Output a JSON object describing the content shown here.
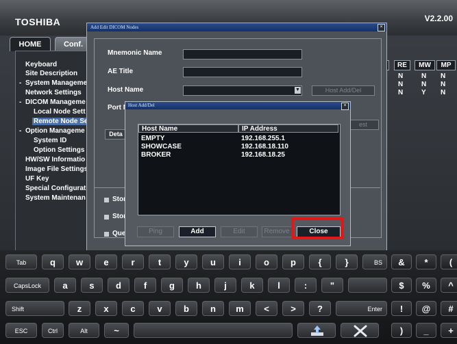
{
  "app": {
    "brand": "TOSHIBA",
    "version": "V2.2.00"
  },
  "tabs": [
    {
      "label": "HOME"
    },
    {
      "label": "Conf."
    }
  ],
  "tree": [
    {
      "label": "Keyboard"
    },
    {
      "label": "Site Description"
    },
    {
      "label": "System Manageme"
    },
    {
      "label": "Network Settings"
    },
    {
      "label": "DICOM Manageme"
    },
    {
      "label": "Local Node Sett"
    },
    {
      "label": "Remote Node Se"
    },
    {
      "label": "Option Manageme"
    },
    {
      "label": "System ID"
    },
    {
      "label": "Option Settings"
    },
    {
      "label": "HW/SW Informatio"
    },
    {
      "label": "Image File Settings"
    },
    {
      "label": "UF Key"
    },
    {
      "label": "Special Configurat"
    },
    {
      "label": "System Maintenan"
    }
  ],
  "right_table": {
    "headers": [
      "J",
      "RE",
      "MW",
      "MP"
    ],
    "rows": [
      [
        "N",
        "N",
        "N"
      ],
      [
        "N",
        "N",
        "N"
      ],
      [
        "N",
        "Y",
        "N"
      ]
    ]
  },
  "dicom_dialog": {
    "title": "Add Edit DICOM Nodes",
    "close_glyph": "×",
    "fields": {
      "mnemonic_label": "Mnemonic Name",
      "ae_title_label": "AE Title",
      "host_name_label": "Host Name",
      "port_label": "Port N"
    },
    "host_add_del_button": "Host Add/Del",
    "detail_button": "Deta",
    "test_button": "est",
    "checkbox_labels": [
      "Stor",
      "Stor",
      "Que"
    ]
  },
  "host_dialog": {
    "title": "Host Add/Del",
    "close_glyph": "×",
    "columns": [
      "Host Name",
      "IP Address"
    ],
    "rows": [
      {
        "host": "EMPTY",
        "ip": "192.168.255.1"
      },
      {
        "host": "SHOWCASE",
        "ip": "192.168.18.110"
      },
      {
        "host": "BROKER",
        "ip": "192.168.18.25"
      }
    ],
    "buttons": {
      "ping": "Ping",
      "add": "Add",
      "edit": "Edit",
      "remove": "Remove",
      "close": "Close"
    }
  },
  "highlight_color": "#e01818",
  "keyboard": {
    "row1": [
      "Tab",
      "q",
      "w",
      "e",
      "r",
      "t",
      "y",
      "u",
      "i",
      "o",
      "p",
      "{",
      "}",
      "BS",
      "&",
      "*",
      "("
    ],
    "row2": [
      "CapsLock",
      "a",
      "s",
      "d",
      "f",
      "g",
      "h",
      "j",
      "k",
      "l",
      ":",
      "\"",
      "",
      "$",
      "%",
      "^"
    ],
    "row3": [
      "Shift",
      "z",
      "x",
      "c",
      "v",
      "b",
      "n",
      "m",
      "<",
      ">",
      "?",
      "Enter",
      "!",
      "@",
      "#"
    ],
    "row4": [
      "ESC",
      "Ctrl",
      "Alt",
      "~",
      "",
      ")",
      "_",
      "+"
    ],
    "icons": {
      "enter_icon": "upload-icon",
      "close_icon": "close-icon"
    }
  }
}
